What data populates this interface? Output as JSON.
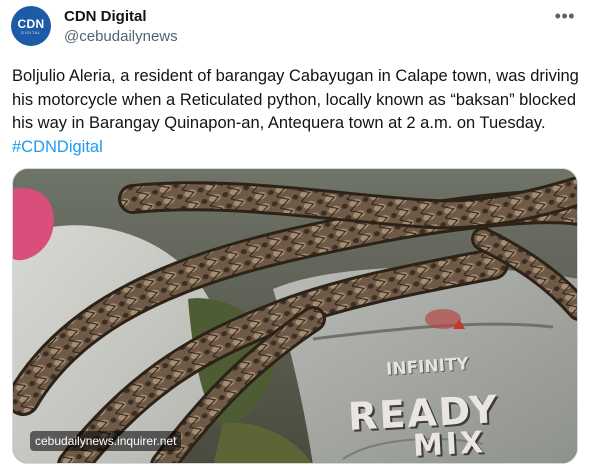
{
  "account": {
    "avatar_logo": "CDN",
    "avatar_subtext": "DIGITAL",
    "display_name": "CDN Digital",
    "handle": "@cebudailynews",
    "more_icon": "more-horizontal-icon"
  },
  "post": {
    "text": "Boljulio Aleria, a resident of barangay Cabayugan in Calape town, was driving his motorcycle when a Reticulated python, locally known as “baksan” blocked his way in Barangay Quinapon-an, Antequera town at 2 a.m. on Tuesday.",
    "hashtag": "#CDNDigital"
  },
  "media": {
    "source_badge": "cebudailynews.inquirer.net",
    "sack_brand": "INFINITY",
    "sack_text_1": "READY",
    "sack_text_2": "MIX"
  },
  "colors": {
    "link": "#1d9bf0",
    "text": "#0f1419",
    "muted": "#536471",
    "avatar_bg": "#1d5aa8"
  }
}
